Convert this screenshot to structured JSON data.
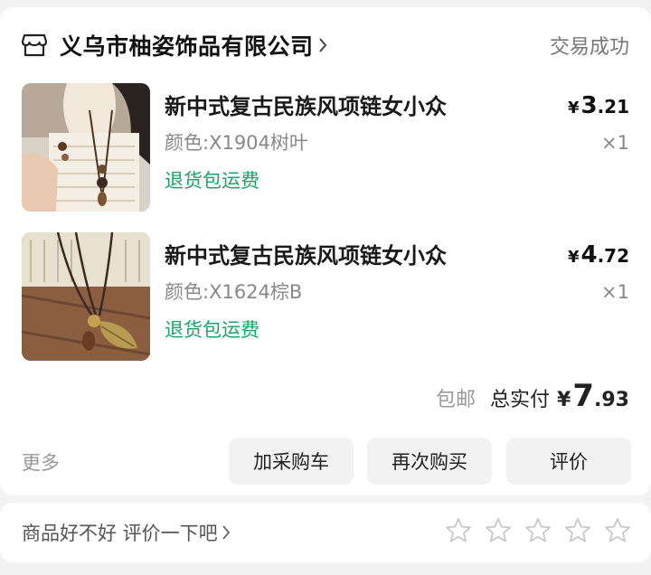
{
  "order": {
    "shop_name": "义乌市柚姿饰品有限公司",
    "status": "交易成功",
    "items": [
      {
        "title": "新中式复古民族风项链女小众",
        "spec": "颜色:X1904树叶",
        "tag": "退货包运费",
        "currency": "¥",
        "price_int": "3",
        "price_dec": ".21",
        "qty": "×1"
      },
      {
        "title": "新中式复古民族风项链女小众",
        "spec": "颜色:X1624棕B",
        "tag": "退货包运费",
        "currency": "¥",
        "price_int": "4",
        "price_dec": ".72",
        "qty": "×1"
      }
    ],
    "shipping": "包邮",
    "total_label": "总实付",
    "total_currency": "¥",
    "total_int": "7",
    "total_dec": ".93"
  },
  "actions": {
    "more": "更多",
    "add_to_cart": "加采购车",
    "buy_again": "再次购买",
    "review": "评价"
  },
  "rating": {
    "prompt": "商品好不好 评价一下吧",
    "stars_total": 5,
    "stars_filled": 0
  },
  "icons": {
    "shop": "store-icon",
    "chevron": "chevron-right-icon",
    "star": "star-outline-icon"
  },
  "colors": {
    "tag_green": "#1aa56c",
    "button_bg": "#f2f2f2",
    "page_bg": "#f2f2f2"
  }
}
